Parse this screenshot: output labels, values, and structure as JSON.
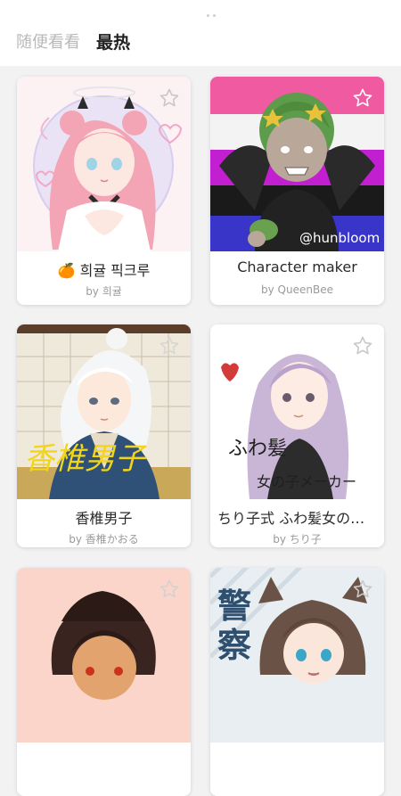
{
  "tabs": [
    {
      "label": "随便看看",
      "active": false
    },
    {
      "label": "最热",
      "active": true
    }
  ],
  "cards": [
    {
      "title": "🍊 희귤 픽크루",
      "author": "by 희귤"
    },
    {
      "title": "Character maker",
      "author": "by QueenBee"
    },
    {
      "title": "香椎男子",
      "author": "by 香椎かおる"
    },
    {
      "title": "ちり子式 ふわ髪女の子メーカー",
      "author": "by ちり子"
    },
    {
      "title": "",
      "author": ""
    },
    {
      "title": "",
      "author": ""
    }
  ],
  "artwork_text": {
    "card2_watermark": "@hunbloom",
    "card3_calligraphy": "香椎男子",
    "card4_handwriting_1": "ふわ髪",
    "card4_handwriting_2": "女の子メーカー",
    "card6_kanji_1": "警",
    "card6_kanji_2": "察"
  },
  "colors": {
    "background": "#f2f2f3",
    "card": "#ffffff",
    "active_tab": "#222222",
    "inactive_tab": "#b9b9b9",
    "star_outline": "#c8c8c8"
  },
  "icons": {
    "favorite": "star-outline-icon"
  }
}
